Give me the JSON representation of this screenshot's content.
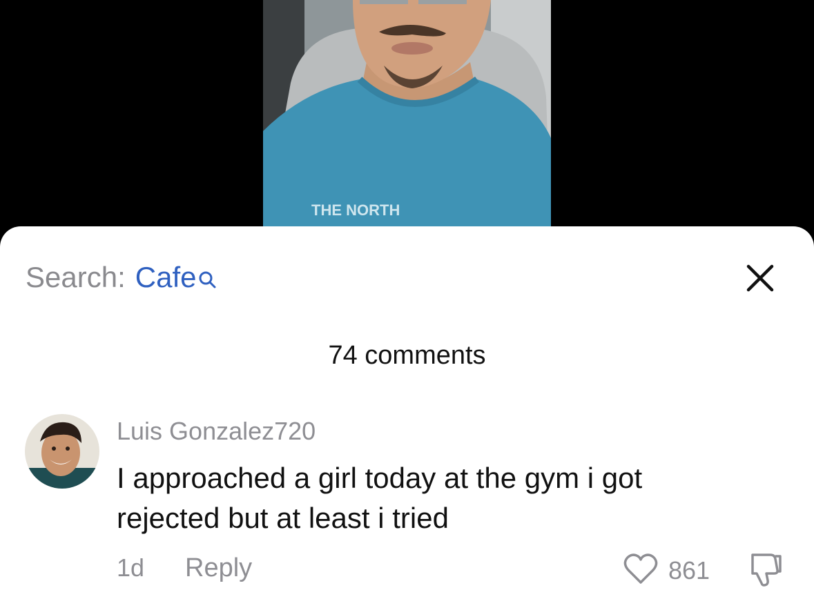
{
  "search": {
    "prefix": "Search:",
    "term": "Cafe"
  },
  "comments_count_label": "74 comments",
  "comment": {
    "username": "Luis Gonzalez720",
    "text": "I approached a girl today at the gym i got rejected but at least i tried",
    "time": "1d",
    "reply_label": "Reply",
    "likes": "861"
  },
  "video": {
    "shirt_text": "THE NORTH"
  },
  "colors": {
    "search_term": "#2f60c0",
    "muted_text": "#8e8e93",
    "sheet_background": "#ffffff",
    "video_background": "#000000"
  },
  "icons": {
    "search": "search-icon",
    "close": "close-icon",
    "like": "heart-icon",
    "dislike": "thumbs-down-icon"
  }
}
